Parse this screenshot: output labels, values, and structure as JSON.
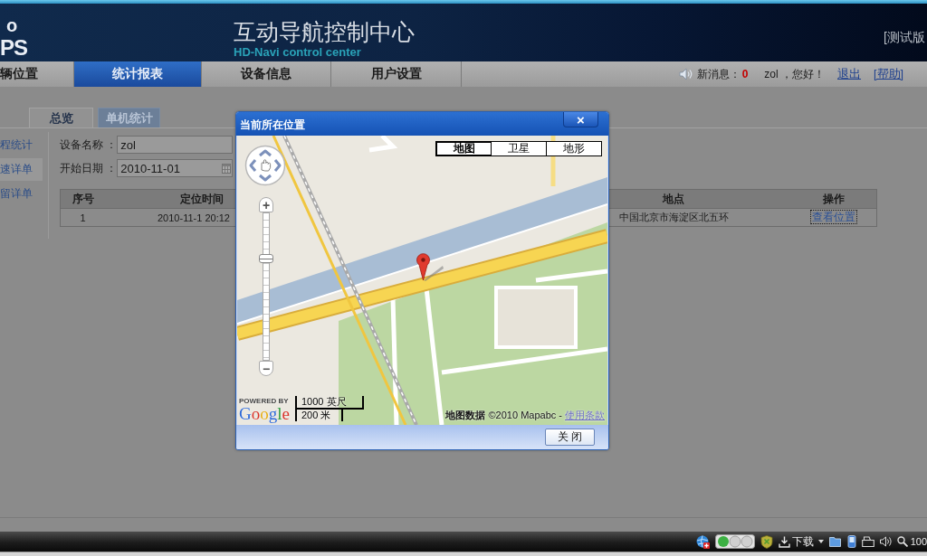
{
  "header": {
    "logo_lines": [
      "o",
      "PS"
    ],
    "title": "互动导航控制中心",
    "subtitle": "HD-Navi control center",
    "edition": "[测试版"
  },
  "nav": {
    "tabs": [
      {
        "label": "辆位置",
        "selected": false
      },
      {
        "label": "统计报表",
        "selected": true
      },
      {
        "label": "设备信息",
        "selected": false
      },
      {
        "label": "用户设置",
        "selected": false
      }
    ],
    "messages_label": "新消息：",
    "message_count": "0",
    "greeting": "zol ，您好！",
    "logout": "退出",
    "help": "[帮助]"
  },
  "sub_tabs": [
    {
      "label": "总览",
      "selected": false
    },
    {
      "label": "单机统计",
      "selected": true
    }
  ],
  "sidebar": {
    "items": [
      {
        "label": "程统计",
        "selected": false
      },
      {
        "label": "速详单",
        "selected": true
      },
      {
        "label": "留详单",
        "selected": false
      }
    ]
  },
  "form": {
    "fields": [
      {
        "label": "设备名称 ：",
        "value": "zol",
        "kind": "text"
      },
      {
        "label": "开始日期 ：",
        "value": "2010-11-01",
        "kind": "date"
      }
    ]
  },
  "table": {
    "columns": [
      "序号",
      "定位时间",
      "地点",
      "操作"
    ],
    "rows": [
      {
        "cells": [
          "1",
          "2010-11-1 20:12",
          "中国北京市海淀区北五环"
        ],
        "action": "查看位置",
        "focused": true
      }
    ]
  },
  "dialog": {
    "title": "当前所在位置",
    "close": "×",
    "map": {
      "types": [
        {
          "label": "地图",
          "selected": true
        },
        {
          "label": "卫星",
          "selected": false
        },
        {
          "label": "地形",
          "selected": false
        }
      ],
      "zoom_in": "+",
      "zoom_out": "−",
      "zoom_slider": {
        "level": 0.69
      },
      "powered_by": "POWERED BY",
      "logo": "Google",
      "scale": [
        "1000 英尺",
        "200 米"
      ],
      "copyright": "**地图数据** ©2010 Mapabc -",
      "terms": "使用条款"
    },
    "buttons": [
      "关 闭"
    ]
  },
  "taskbar": {
    "download": "下载",
    "zoom_level": "100"
  }
}
